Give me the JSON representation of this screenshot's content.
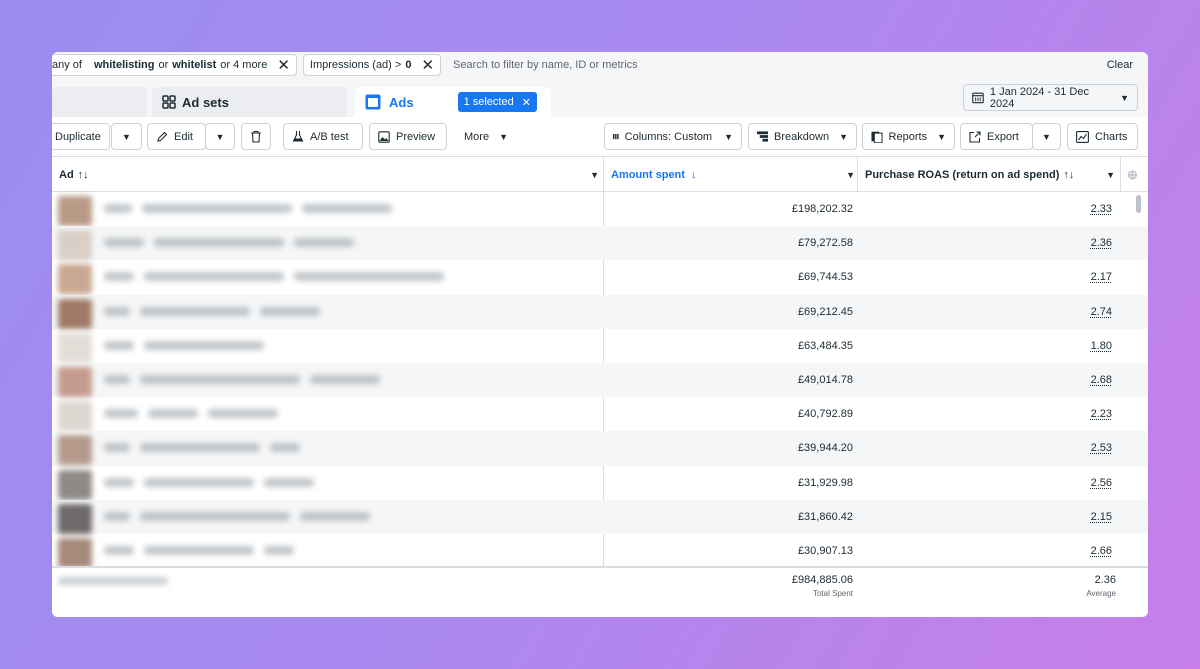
{
  "filters": {
    "chip1": {
      "prefix": "any of",
      "term1": "whitelisting",
      "or1": "or",
      "term2": "whitelist",
      "more": "or 4 more"
    },
    "chip2": {
      "label": "Impressions (ad) >",
      "value": "0"
    },
    "search_placeholder": "Search to filter by name, ID or metrics",
    "clear_label": "Clear"
  },
  "tabs": {
    "adsets_label": "Ad sets",
    "ads_label": "Ads",
    "selected_label": "1 selected"
  },
  "date_range": "1 Jan 2024 - 31 Dec 2024",
  "toolbar": {
    "duplicate": "Duplicate",
    "edit": "Edit",
    "ab_test": "A/B test",
    "preview": "Preview",
    "more": "More",
    "columns": "Columns: Custom",
    "breakdown": "Breakdown",
    "reports": "Reports",
    "export": "Export",
    "charts": "Charts"
  },
  "table": {
    "col_ad": "Ad",
    "col_spent": "Amount spent",
    "col_roas": "Purchase ROAS (return on ad spend)",
    "rows": [
      {
        "spent": "£198,202.32",
        "roas": "2.33"
      },
      {
        "spent": "£79,272.58",
        "roas": "2.36"
      },
      {
        "spent": "£69,744.53",
        "roas": "2.17"
      },
      {
        "spent": "£69,212.45",
        "roas": "2.74"
      },
      {
        "spent": "£63,484.35",
        "roas": "1.80"
      },
      {
        "spent": "£49,014.78",
        "roas": "2.68"
      },
      {
        "spent": "£40,792.89",
        "roas": "2.23"
      },
      {
        "spent": "£39,944.20",
        "roas": "2.53"
      },
      {
        "spent": "£31,929.98",
        "roas": "2.56"
      },
      {
        "spent": "£31,860.42",
        "roas": "2.15"
      },
      {
        "spent": "£30,907.13",
        "roas": "2.66"
      }
    ],
    "totals": {
      "spent": "£984,885.06",
      "spent_caption": "Total Spent",
      "roas": "2.36",
      "roas_caption": "Average"
    }
  },
  "colors": {
    "accent": "#1877f2",
    "text": "#1c2b33",
    "alt_row": "#f5f6f7"
  }
}
